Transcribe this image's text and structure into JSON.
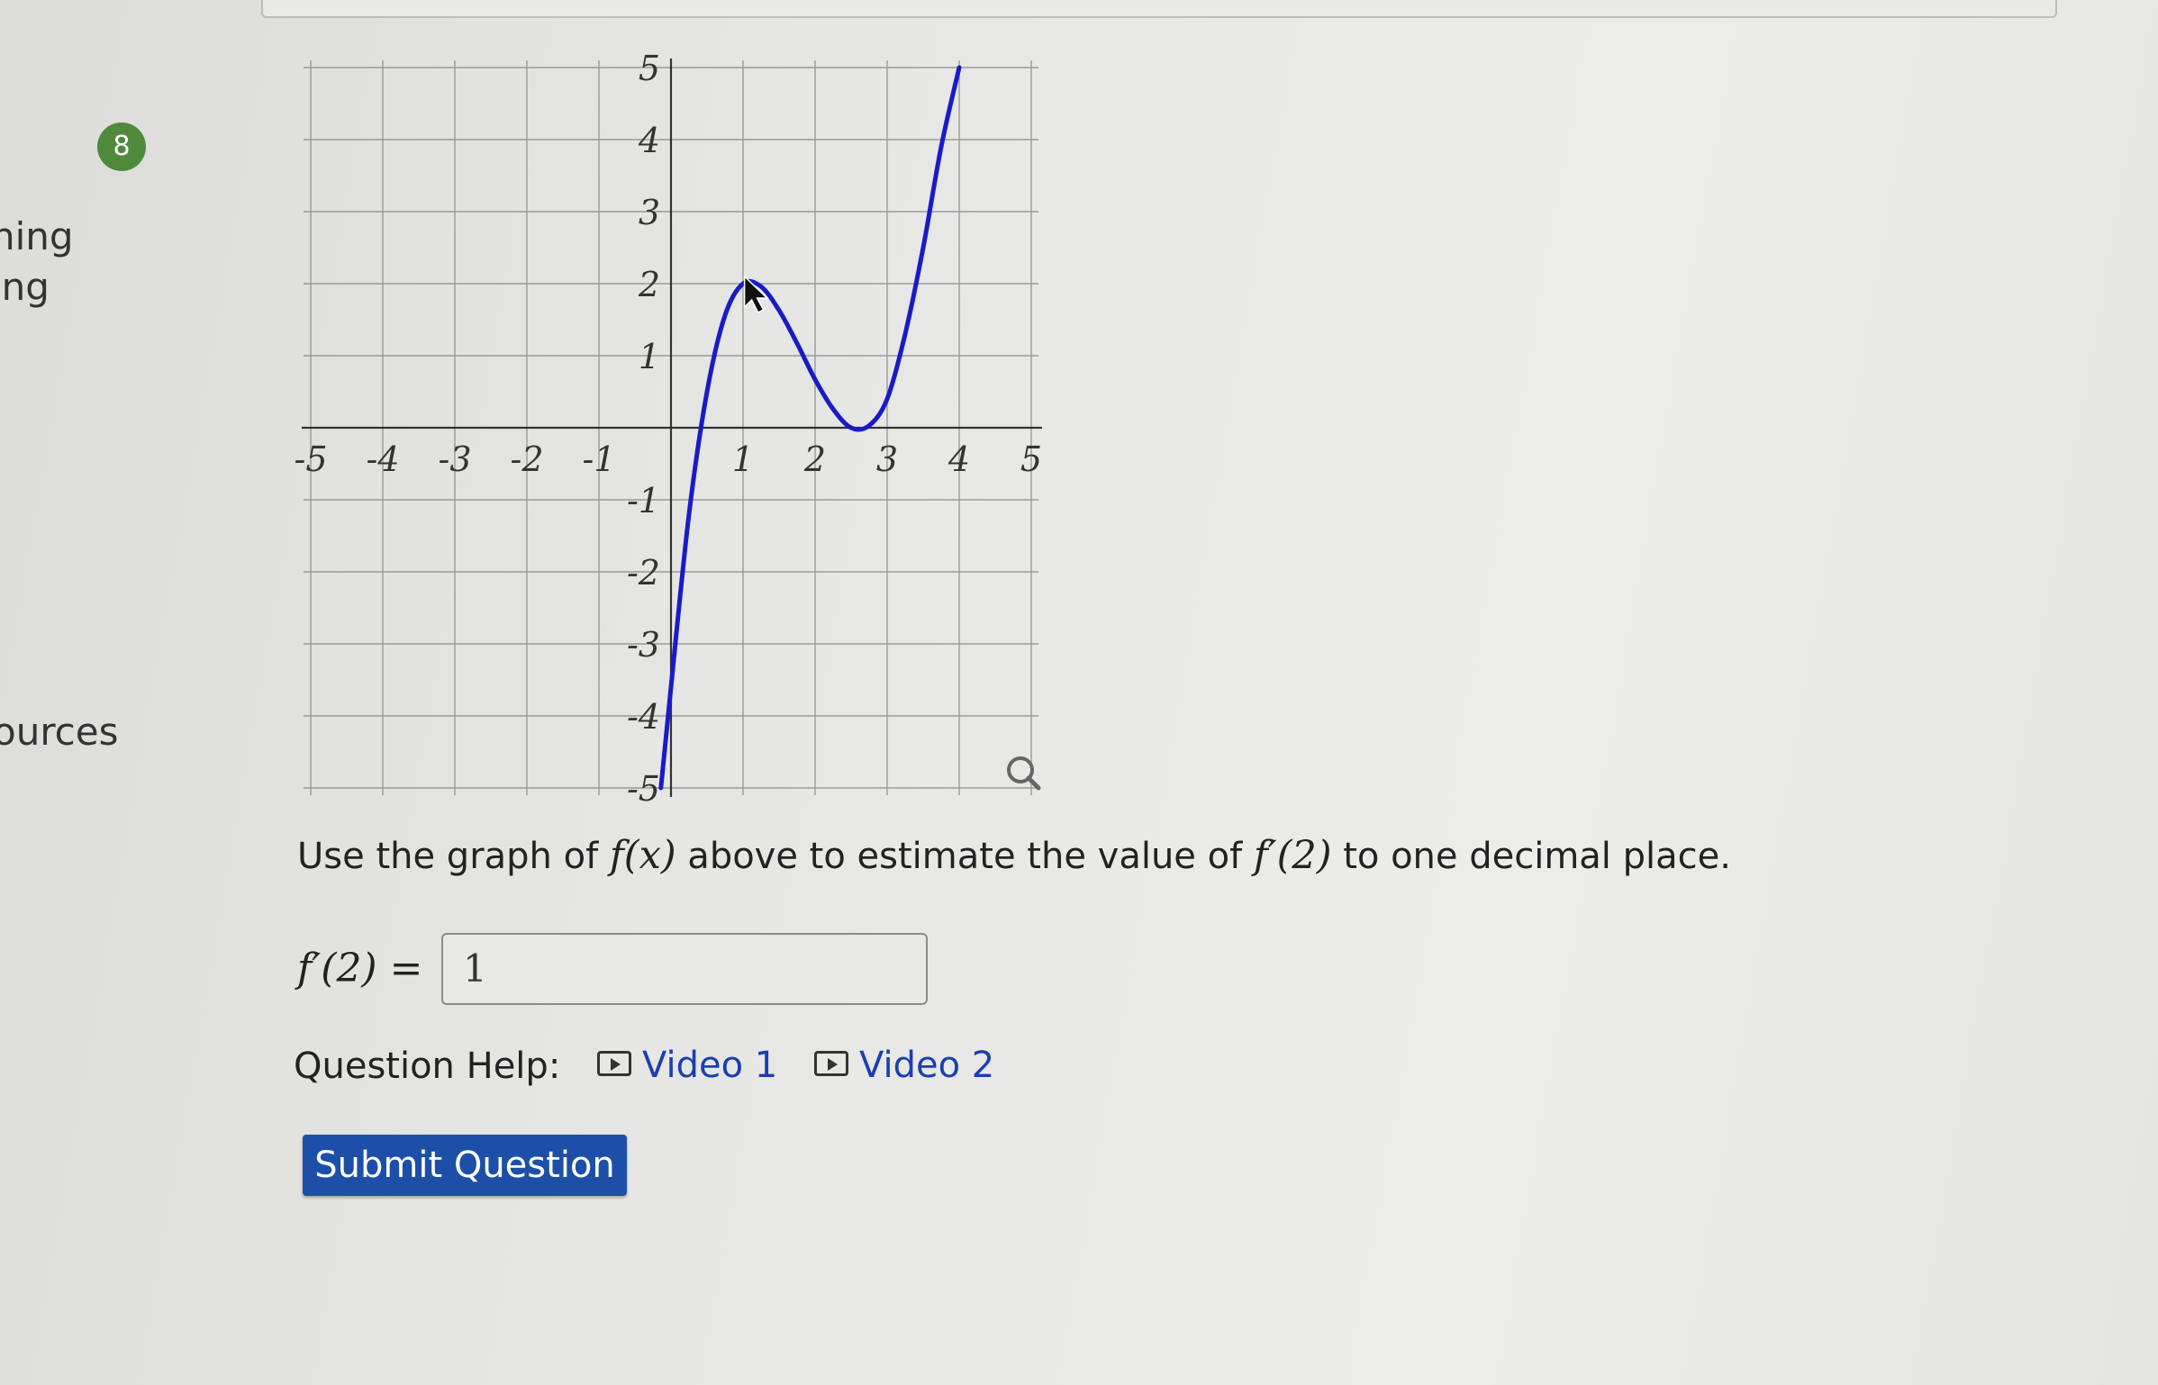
{
  "sidebar": {
    "line1": "ning",
    "line2": "ing",
    "line3": "ources"
  },
  "question": {
    "number": "8",
    "prompt_prefix": "Use the graph of ",
    "prompt_fx": "f(x)",
    "prompt_mid": " above to estimate the value of ",
    "prompt_fprime": "f′(2)",
    "prompt_suffix": " to one decimal place.",
    "answer_label": "f′(2) =",
    "answer_value": "1",
    "help_label": "Question Help:",
    "video1": "Video 1",
    "video2": "Video 2",
    "submit_label": "Submit Question"
  },
  "colors": {
    "curve": "#1a1ac8",
    "submit_bg": "#1d4fa8",
    "link": "#1a3fb0",
    "badge": "#4f8a3c"
  },
  "chart_data": {
    "type": "line",
    "title": "",
    "xlabel": "",
    "ylabel": "",
    "xlim": [
      -5,
      5
    ],
    "ylim": [
      -5,
      5
    ],
    "grid": true,
    "x_ticks": [
      "-5",
      "-4",
      "-3",
      "-2",
      "-1",
      "1",
      "2",
      "3",
      "4",
      "5"
    ],
    "y_ticks": [
      "5",
      "4",
      "3",
      "2",
      "1",
      "-1",
      "-2",
      "-3",
      "-4",
      "-5"
    ],
    "series": [
      {
        "x": [
          -0.14,
          0,
          0.25,
          0.5,
          0.75,
          1,
          1.25,
          1.5,
          1.75,
          2,
          2.25,
          2.5,
          2.75,
          3,
          3.25,
          3.5,
          3.75,
          4
        ],
        "y": [
          -5,
          -3.6,
          -1.2,
          0.5,
          1.56,
          2.0,
          1.96,
          1.63,
          1.17,
          0.67,
          0.26,
          0.0,
          0.03,
          0.4,
          1.3,
          2.5,
          3.9,
          5.0
        ]
      }
    ]
  }
}
